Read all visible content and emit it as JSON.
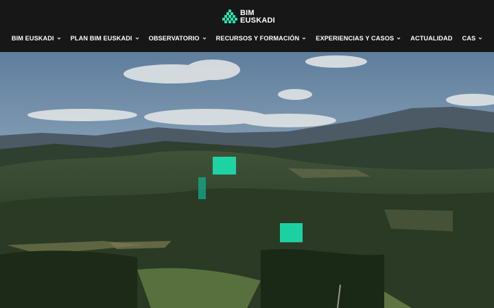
{
  "brand": {
    "line1": "BIM",
    "line2": "EUSKADI",
    "icon": "checkered-triangle-logo-icon",
    "accent_color": "#1ae6b3"
  },
  "nav": {
    "items": [
      {
        "label": "BIM EUSKADI",
        "has_dropdown": true
      },
      {
        "label": "PLAN BIM EUSKADI",
        "has_dropdown": true
      },
      {
        "label": "OBSERVATORIO",
        "has_dropdown": true
      },
      {
        "label": "RECURSOS Y FORMACIÓN",
        "has_dropdown": true
      },
      {
        "label": "EXPERIENCIAS Y CASOS",
        "has_dropdown": true
      },
      {
        "label": "ACTUALIDAD",
        "has_dropdown": false
      },
      {
        "label": "CAS",
        "has_dropdown": true
      }
    ]
  },
  "colors": {
    "header_bg": "#171717",
    "text": "#ffffff"
  }
}
